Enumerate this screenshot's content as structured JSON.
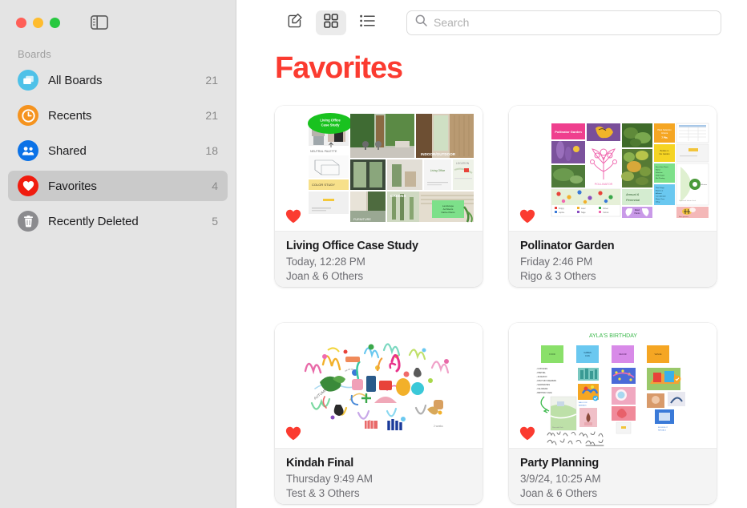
{
  "window": {
    "traffic_lights": [
      "close",
      "minimize",
      "zoom"
    ],
    "sidebar_toggle_icon": "sidebar-toggle-icon"
  },
  "sidebar": {
    "section_label": "Boards",
    "items": [
      {
        "label": "All Boards",
        "count": "21",
        "icon": "boards-icon",
        "color": "#4ec1e8",
        "selected": false
      },
      {
        "label": "Recents",
        "count": "21",
        "icon": "clock-icon",
        "color": "#f5931e",
        "selected": false
      },
      {
        "label": "Shared",
        "count": "18",
        "icon": "people-icon",
        "color": "#0b72e7",
        "selected": false
      },
      {
        "label": "Favorites",
        "count": "4",
        "icon": "heart-icon",
        "color": "#f01c0f",
        "selected": true
      },
      {
        "label": "Recently Deleted",
        "count": "5",
        "icon": "trash-icon",
        "color": "#8b8b8e",
        "selected": false
      }
    ]
  },
  "toolbar": {
    "compose_label": "new-board",
    "grid_view_label": "grid-view",
    "list_view_label": "list-view",
    "active_view": "grid",
    "search": {
      "value": "",
      "placeholder": "Search"
    }
  },
  "main": {
    "title": "Favorites",
    "title_color": "#fb3b30"
  },
  "boards": [
    {
      "title": "Living Office Case Study",
      "date": "Today, 12:28 PM",
      "collaborators": "Joan & 6 Others",
      "favorite": true,
      "thumbnail": "moodboard-interior-office",
      "sticky_label": "Living Office Case Study"
    },
    {
      "title": "Pollinator Garden",
      "date": "Friday 2:46 PM",
      "collaborators": "Rigo & 3 Others",
      "favorite": true,
      "thumbnail": "moodboard-garden-plants",
      "sticky_label": "Pollinator Garden"
    },
    {
      "title": "Kindah Final",
      "date": "Thursday 9:49 AM",
      "collaborators": "Test & 3 Others",
      "favorite": true,
      "thumbnail": "colorful-doodle-collage",
      "sticky_label": ""
    },
    {
      "title": "Party Planning",
      "date": "3/9/24, 10:25 AM",
      "collaborators": "Joan & 6 Others",
      "favorite": true,
      "thumbnail": "birthday-party-board",
      "sticky_label": "AYLA'S BIRTHDAY"
    }
  ]
}
